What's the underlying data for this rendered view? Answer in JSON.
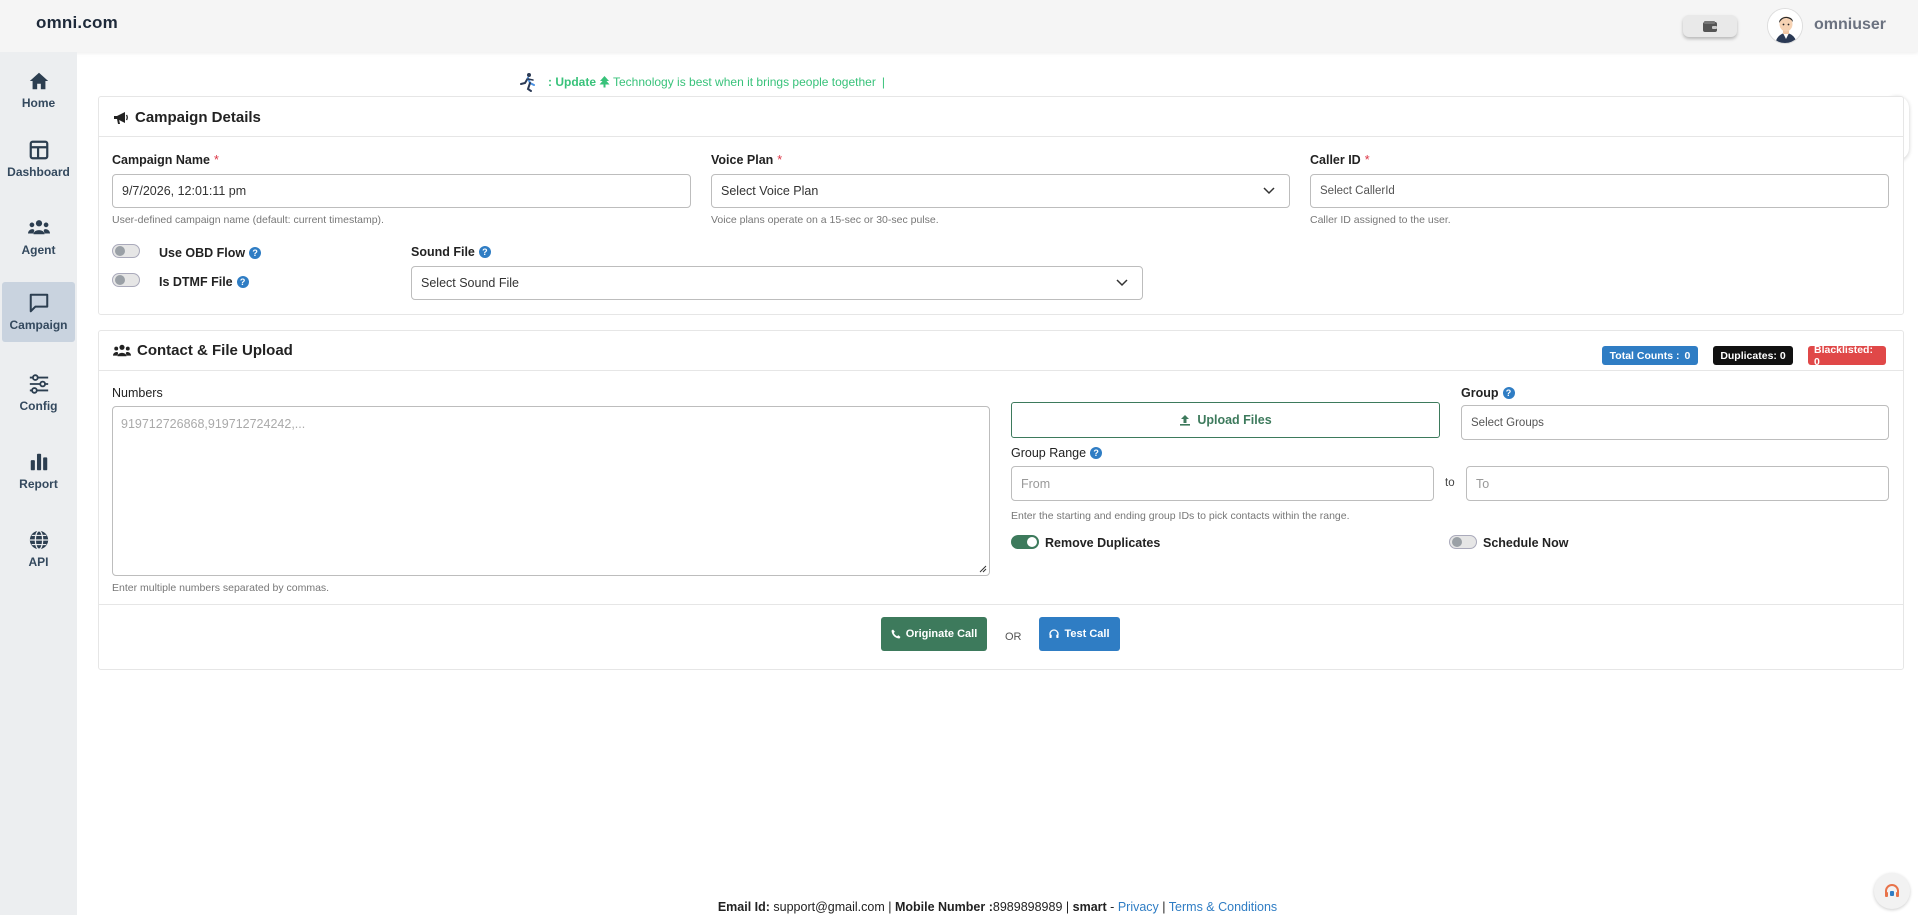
{
  "header": {
    "brand": "omni.com",
    "username": "omniuser",
    "wallet_icon": "wallet-icon",
    "avatar_icon": "user-avatar"
  },
  "sidebar": {
    "items": [
      {
        "label": "Home",
        "icon": "home-icon"
      },
      {
        "label": "Dashboard",
        "icon": "dashboard-icon"
      },
      {
        "label": "Agent",
        "icon": "users-icon"
      },
      {
        "label": "Campaign",
        "icon": "chat-icon",
        "active": true
      },
      {
        "label": "Config",
        "icon": "sliders-icon"
      },
      {
        "label": "Report",
        "icon": "bar-chart-icon"
      },
      {
        "label": "API",
        "icon": "globe-icon"
      }
    ]
  },
  "marquee": {
    "prefix": ": Update",
    "text": "Technology is best when it brings people together",
    "cursor": "|"
  },
  "campaign": {
    "title": "Campaign Details",
    "campaign_name": {
      "label": "Campaign Name",
      "value": "9/7/2026, 12:01:11 pm",
      "help": "User-defined campaign name (default: current timestamp)."
    },
    "voice_plan": {
      "label": "Voice Plan",
      "value": "Select Voice Plan",
      "help": "Voice plans operate on a 15-sec or 30-sec pulse."
    },
    "caller_id": {
      "label": "Caller ID",
      "placeholder": "Select CallerId",
      "help": "Caller ID assigned to the user."
    },
    "use_obd_flow": {
      "label": "Use OBD Flow",
      "on": false
    },
    "is_dtmf_file": {
      "label": "Is DTMF File",
      "on": false
    },
    "sound_file": {
      "label": "Sound File",
      "value": "Select Sound File"
    },
    "required_mark": "*",
    "help_mark": "?"
  },
  "contact": {
    "title": "Contact & File Upload",
    "badges": {
      "total": "Total Counts :",
      "total_value": "0",
      "duplicates": "Duplicates: 0",
      "blacklisted": "Blacklisted: 0"
    },
    "numbers": {
      "label": "Numbers",
      "placeholder": "919712726868,919712724242,...",
      "help": "Enter multiple numbers separated by commas."
    },
    "upload_label": "Upload Files",
    "group": {
      "label": "Group",
      "placeholder": "Select Groups"
    },
    "group_range": {
      "label": "Group Range",
      "from_placeholder": "From",
      "to_placeholder": "To",
      "to_word": "to",
      "help": "Enter the starting and ending group IDs to pick contacts within the range."
    },
    "remove_duplicates": {
      "label": "Remove Duplicates",
      "on": true
    },
    "schedule_now": {
      "label": "Schedule Now",
      "on": false
    },
    "originate_label": "Originate Call",
    "or_word": "OR",
    "test_label": "Test Call"
  },
  "footer": {
    "email_label": "Email Id:",
    "email": "support@gmail.com",
    "sep1": "|",
    "mobile_label": "Mobile Number :",
    "mobile": "8989898989",
    "sep2": "|",
    "brand": "smart",
    "dash": "-",
    "privacy": "Privacy",
    "sep3": "|",
    "terms": "Terms & Conditions"
  },
  "colors": {
    "primary_green": "#3d7a5c",
    "info_blue": "#2f7dc4",
    "danger_red": "#e04848",
    "dark": "#111111",
    "marquee_green": "#38c27a"
  }
}
